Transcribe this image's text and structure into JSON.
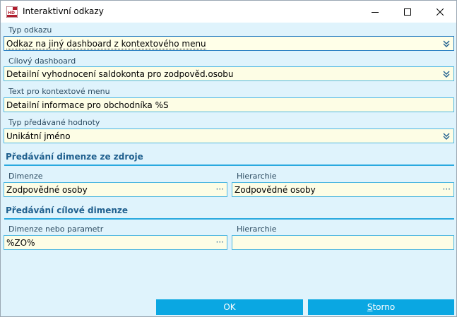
{
  "window": {
    "title": "Interaktivní odkazy",
    "app_icon": "hd-app-icon",
    "controls": {
      "minimize": "minimize-icon",
      "maximize": "maximize-icon",
      "close": "close-icon"
    }
  },
  "fields": {
    "link_type": {
      "label": "Typ odkazu",
      "value": "Odkaz na jiný dashboard z kontextového menu"
    },
    "target_dashboard": {
      "label": "Cílový dashboard",
      "value": "Detailní vyhodnocení saldokonta pro zodpověd.osobu"
    },
    "context_menu_text": {
      "label": "Text pro kontextové menu",
      "value": "Detailní informace pro obchodníka %S"
    },
    "passed_value_type": {
      "label": "Typ předávané hodnoty",
      "value": "Unikátní jméno"
    }
  },
  "source_section": {
    "title": "Předávání dimenze ze zdroje",
    "dimension": {
      "label": "Dimenze",
      "value": "Zodpovědné osoby"
    },
    "hierarchy": {
      "label": "Hierarchie",
      "value": "Zodpovědné osoby"
    }
  },
  "target_section": {
    "title": "Předávání cílové dimenze",
    "dimension": {
      "label": "Dimenze nebo parametr",
      "value": "%ZO%"
    },
    "hierarchy": {
      "label": "Hierarchie",
      "value": ""
    }
  },
  "ellipsis": "···",
  "buttons": {
    "ok": {
      "label": "OK"
    },
    "cancel": {
      "accel": "S",
      "rest": "torno"
    }
  },
  "colors": {
    "dialog_bg": "#dff3fc",
    "field_bg": "#fdfde5",
    "field_border": "#4fb8e1",
    "accent": "#0aa7e2",
    "section_text": "#1f5f8e"
  }
}
